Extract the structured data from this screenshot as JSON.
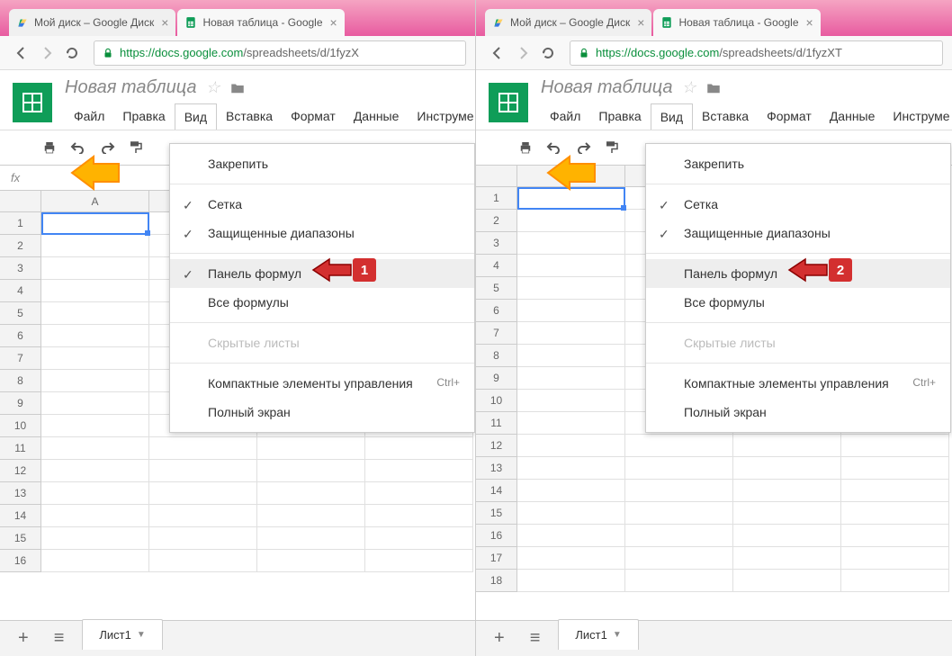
{
  "left": {
    "tabs": [
      {
        "title": "Мой диск – Google Диск",
        "active": false
      },
      {
        "title": "Новая таблица - Google",
        "active": true
      }
    ],
    "url_host": "https",
    "url_domain": "://docs.google.com",
    "url_path": "/spreadsheets/d/1fyzX",
    "doc_title": "Новая таблица",
    "menus": [
      "Файл",
      "Правка",
      "Вид",
      "Вставка",
      "Формат",
      "Данные",
      "Инструме"
    ],
    "open_menu_index": 2,
    "fx_label": "fx",
    "col_header": "A",
    "row_count": 16,
    "selected_row": 1,
    "has_formula_bar": true,
    "dropdown": {
      "items": [
        {
          "label": "Закрепить",
          "checked": false,
          "highlighted": false,
          "disabled": false,
          "shortcut": ""
        },
        {
          "sep": true
        },
        {
          "label": "Сетка",
          "checked": true,
          "highlighted": false,
          "disabled": false,
          "shortcut": ""
        },
        {
          "label": "Защищенные диапазоны",
          "checked": true,
          "highlighted": false,
          "disabled": false,
          "shortcut": ""
        },
        {
          "sep": true
        },
        {
          "label": "Панель формул",
          "checked": true,
          "highlighted": true,
          "disabled": false,
          "shortcut": ""
        },
        {
          "label": "Все формулы",
          "checked": false,
          "highlighted": false,
          "disabled": false,
          "shortcut": ""
        },
        {
          "sep": true
        },
        {
          "label": "Скрытые листы",
          "checked": false,
          "highlighted": false,
          "disabled": true,
          "shortcut": ""
        },
        {
          "sep": true
        },
        {
          "label": "Компактные элементы управления",
          "checked": false,
          "highlighted": false,
          "disabled": false,
          "shortcut": "Ctrl+"
        },
        {
          "label": "Полный экран",
          "checked": false,
          "highlighted": false,
          "disabled": false,
          "shortcut": ""
        }
      ]
    },
    "marker_num": "1",
    "sheet_name": "Лист1"
  },
  "right": {
    "tabs": [
      {
        "title": "Мой диск – Google Диск",
        "active": false
      },
      {
        "title": "Новая таблица - Google",
        "active": true
      }
    ],
    "url_host": "https",
    "url_domain": "://docs.google.com",
    "url_path": "/spreadsheets/d/1fyzXT",
    "doc_title": "Новая таблица",
    "menus": [
      "Файл",
      "Правка",
      "Вид",
      "Вставка",
      "Формат",
      "Данные",
      "Инструме"
    ],
    "open_menu_index": 2,
    "col_header": "A",
    "row_count": 18,
    "selected_row": 1,
    "has_formula_bar": false,
    "dropdown": {
      "items": [
        {
          "label": "Закрепить",
          "checked": false,
          "highlighted": false,
          "disabled": false,
          "shortcut": ""
        },
        {
          "sep": true
        },
        {
          "label": "Сетка",
          "checked": true,
          "highlighted": false,
          "disabled": false,
          "shortcut": ""
        },
        {
          "label": "Защищенные диапазоны",
          "checked": true,
          "highlighted": false,
          "disabled": false,
          "shortcut": ""
        },
        {
          "sep": true
        },
        {
          "label": "Панель формул",
          "checked": false,
          "highlighted": true,
          "disabled": false,
          "shortcut": ""
        },
        {
          "label": "Все формулы",
          "checked": false,
          "highlighted": false,
          "disabled": false,
          "shortcut": ""
        },
        {
          "sep": true
        },
        {
          "label": "Скрытые листы",
          "checked": false,
          "highlighted": false,
          "disabled": true,
          "shortcut": ""
        },
        {
          "sep": true
        },
        {
          "label": "Компактные элементы управления",
          "checked": false,
          "highlighted": false,
          "disabled": false,
          "shortcut": "Ctrl+"
        },
        {
          "label": "Полный экран",
          "checked": false,
          "highlighted": false,
          "disabled": false,
          "shortcut": ""
        }
      ]
    },
    "marker_num": "2",
    "sheet_name": "Лист1"
  }
}
